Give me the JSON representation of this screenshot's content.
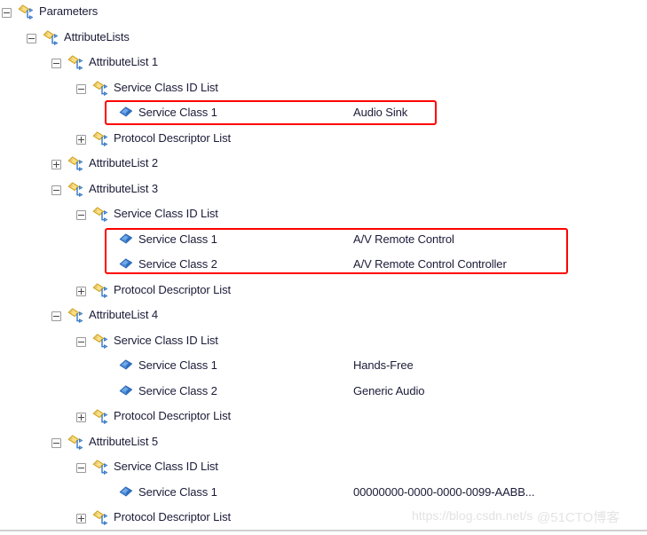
{
  "tree": {
    "rows": [
      {
        "indent": 0,
        "expander": "minus",
        "icon": "attribute-node-icon",
        "label": "Parameters",
        "value": ""
      },
      {
        "indent": 1,
        "expander": "minus",
        "icon": "attribute-node-icon",
        "label": "AttributeLists",
        "value": ""
      },
      {
        "indent": 2,
        "expander": "minus",
        "icon": "attribute-node-icon",
        "label": "AttributeList 1",
        "value": ""
      },
      {
        "indent": 3,
        "expander": "minus",
        "icon": "attribute-node-icon",
        "label": "Service Class ID List",
        "value": ""
      },
      {
        "indent": 4,
        "expander": "none",
        "icon": "service-class-leaf-icon",
        "label": "Service Class 1",
        "value": "Audio Sink"
      },
      {
        "indent": 3,
        "expander": "plus",
        "icon": "attribute-node-icon",
        "label": "Protocol Descriptor List",
        "value": ""
      },
      {
        "indent": 2,
        "expander": "plus",
        "icon": "attribute-node-icon",
        "label": "AttributeList 2",
        "value": ""
      },
      {
        "indent": 2,
        "expander": "minus",
        "icon": "attribute-node-icon",
        "label": "AttributeList 3",
        "value": ""
      },
      {
        "indent": 3,
        "expander": "minus",
        "icon": "attribute-node-icon",
        "label": "Service Class ID List",
        "value": ""
      },
      {
        "indent": 4,
        "expander": "none",
        "icon": "service-class-leaf-icon",
        "label": "Service Class 1",
        "value": "A/V Remote Control"
      },
      {
        "indent": 4,
        "expander": "none",
        "icon": "service-class-leaf-icon",
        "label": "Service Class 2",
        "value": "A/V Remote Control Controller"
      },
      {
        "indent": 3,
        "expander": "plus",
        "icon": "attribute-node-icon",
        "label": "Protocol Descriptor List",
        "value": ""
      },
      {
        "indent": 2,
        "expander": "minus",
        "icon": "attribute-node-icon",
        "label": "AttributeList 4",
        "value": ""
      },
      {
        "indent": 3,
        "expander": "minus",
        "icon": "attribute-node-icon",
        "label": "Service Class ID List",
        "value": ""
      },
      {
        "indent": 4,
        "expander": "none",
        "icon": "service-class-leaf-icon",
        "label": "Service Class 1",
        "value": "Hands-Free"
      },
      {
        "indent": 4,
        "expander": "none",
        "icon": "service-class-leaf-icon",
        "label": "Service Class 2",
        "value": "Generic Audio"
      },
      {
        "indent": 3,
        "expander": "plus",
        "icon": "attribute-node-icon",
        "label": "Protocol Descriptor List",
        "value": ""
      },
      {
        "indent": 2,
        "expander": "minus",
        "icon": "attribute-node-icon",
        "label": "AttributeList 5",
        "value": ""
      },
      {
        "indent": 3,
        "expander": "minus",
        "icon": "attribute-node-icon",
        "label": "Service Class ID List",
        "value": ""
      },
      {
        "indent": 4,
        "expander": "none",
        "icon": "service-class-leaf-icon",
        "label": "Service Class 1",
        "value": "00000000-0000-0000-0099-AABB..."
      },
      {
        "indent": 3,
        "expander": "plus",
        "icon": "attribute-node-icon",
        "label": "Protocol Descriptor List",
        "value": ""
      }
    ]
  },
  "annotations": {
    "highlight_color": "#ff0000",
    "boxes": [
      {
        "id": "hl1",
        "covers_rows": [
          4
        ]
      },
      {
        "id": "hl2",
        "covers_rows": [
          9,
          10
        ]
      }
    ]
  },
  "watermark": {
    "url": "https://blog.csdn.net/s",
    "logo": "@51CTO博客"
  },
  "colors": {
    "text": "#1b1b38",
    "folder_icon_gold": "#f5c13a",
    "leaf_icon_blue": "#3f7fd0",
    "background": "#ffffff"
  }
}
